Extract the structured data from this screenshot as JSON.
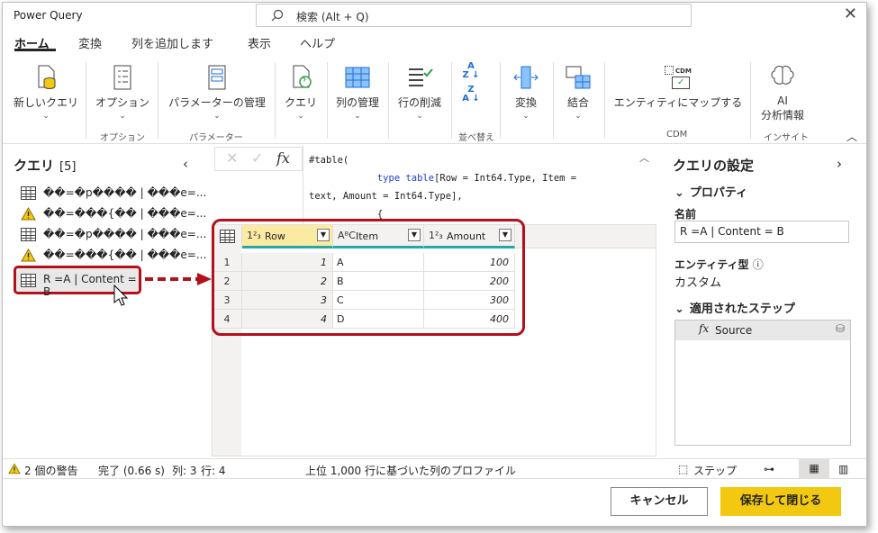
{
  "app": {
    "title": "Power Query"
  },
  "search": {
    "placeholder": "検索 (Alt + Q)"
  },
  "tabs": [
    "ホーム",
    "変換",
    "列を追加します",
    "表示",
    "ヘルプ"
  ],
  "ribbon": {
    "new_query": "新しいクエリ",
    "options": "オプション",
    "params_manage": "パラメーターの管理",
    "query": "クエリ",
    "col_manage": "列の管理",
    "row_reduce": "行の削減",
    "transform": "変換",
    "combine": "結合",
    "entity_map": "エンティティにマップする",
    "ai_line1": "AI",
    "ai_line2": "分析情報",
    "cdm_badge": "CDM",
    "groups": {
      "options": "オプション",
      "params": "パラメーター",
      "sort": "並べ替え",
      "cdm": "CDM",
      "insight": "インサイト"
    }
  },
  "queries": {
    "title": "クエリ",
    "count": "[5]",
    "items": [
      "��=�p���� | ���e=...",
      "��=���{�� | ���e=...",
      "��=�p���� | ���e=...",
      "��=���{�� | ���e=...",
      "R =A | Content = B"
    ]
  },
  "formula": {
    "line1": "#table(",
    "line2_kw": "type table",
    "line2_rest": "[Row = Int64.Type, Item =",
    "line3": "text, Amount = Int64.Type],",
    "line4": "{"
  },
  "grid": {
    "columns": [
      {
        "type": "1²₃",
        "name": "Row"
      },
      {
        "type": "AᴮC",
        "name": "Item"
      },
      {
        "type": "1²₃",
        "name": "Amount"
      }
    ],
    "rows": [
      {
        "n": "1",
        "row": "1",
        "item": "A",
        "amount": "100"
      },
      {
        "n": "2",
        "row": "2",
        "item": "B",
        "amount": "200"
      },
      {
        "n": "3",
        "row": "3",
        "item": "C",
        "amount": "300"
      },
      {
        "n": "4",
        "row": "4",
        "item": "D",
        "amount": "400"
      }
    ]
  },
  "settings": {
    "title": "クエリの設定",
    "properties": "プロパティ",
    "name_label": "名前",
    "name_value": "R =A | Content = B",
    "entity_label": "エンティティ型",
    "entity_value": "カスタム",
    "steps_title": "適用されたステップ",
    "step1": "Source"
  },
  "status": {
    "warnings": "2 個の警告",
    "done": "完了 (0.66 s)",
    "cols": "列: 3",
    "rows": "行: 4",
    "profile": "上位 1,000 行に基づいた列のプロファイル",
    "step_label": "ステップ"
  },
  "footer": {
    "cancel": "キャンセル",
    "save": "保存して閉じる"
  },
  "colors": {
    "accent": "#f2c811",
    "highlight": "#b3101b",
    "teal": "#28a8a2"
  }
}
